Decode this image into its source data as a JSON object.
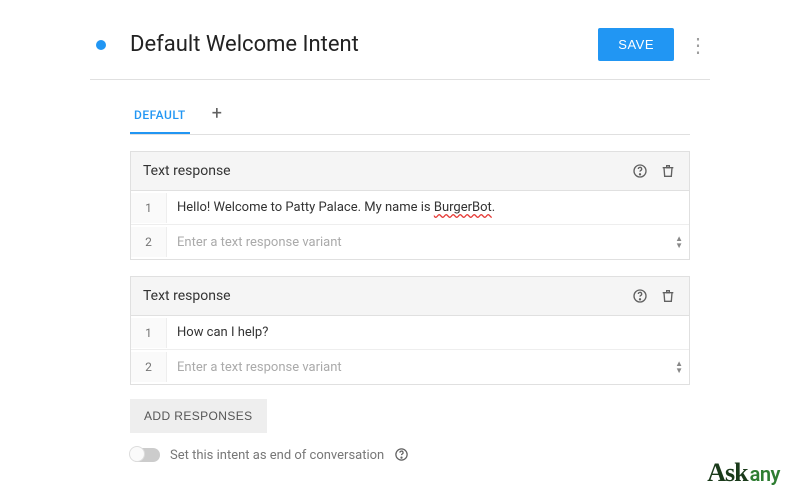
{
  "header": {
    "title": "Default Welcome Intent",
    "save_label": "SAVE"
  },
  "tabs": {
    "default_label": "DEFAULT",
    "add_symbol": "+"
  },
  "cards": [
    {
      "title": "Text response",
      "rows": [
        {
          "num": "1",
          "text_pre": "Hello! Welcome to Patty Palace. My name is ",
          "text_err": "BurgerBot",
          "text_post": "."
        },
        {
          "num": "2",
          "placeholder": "Enter a text response variant"
        }
      ]
    },
    {
      "title": "Text response",
      "rows": [
        {
          "num": "1",
          "text": "How can I help?"
        },
        {
          "num": "2",
          "placeholder": "Enter a text response variant"
        }
      ]
    }
  ],
  "add_responses_label": "ADD RESPONSES",
  "footer": {
    "toggle_label": "Set this intent as end of conversation"
  },
  "watermark": {
    "part1": "Ask",
    "part2": "any"
  }
}
